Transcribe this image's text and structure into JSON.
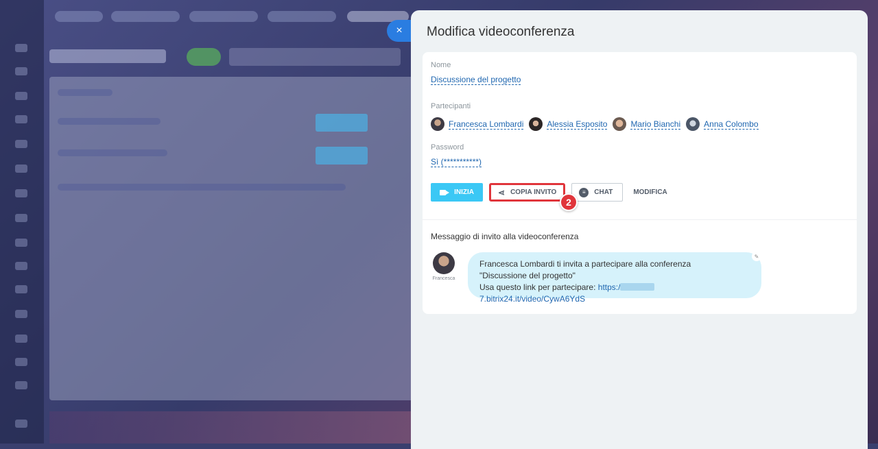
{
  "panel": {
    "title": "Modifica videoconferenza",
    "close_label": "×"
  },
  "conference": {
    "name_label": "Nome",
    "name_value": "Discussione del progetto",
    "participants_label": "Partecipanti",
    "participants": [
      {
        "name": "Francesca Lombardi"
      },
      {
        "name": "Alessia Esposito"
      },
      {
        "name": "Mario Bianchi"
      },
      {
        "name": "Anna Colombo"
      }
    ],
    "password_label": "Password",
    "password_value": "Sì (***********)"
  },
  "actions": {
    "start_label": "INIZIA",
    "copy_label": "COPIA INVITO",
    "chat_label": "CHAT",
    "edit_label": "MODIFICA",
    "step_badge": "2"
  },
  "invite": {
    "heading": "Messaggio di invito alla videoconferenza",
    "sender_name": "Francesca",
    "line1": "Francesca Lombardi ti invita a partecipare alla conferenza",
    "line2": "\"Discussione del progetto\"",
    "line3_prefix": "Usa questo link per partecipare:",
    "link_start": "https:/",
    "link_end": "7.bitrix24.it/video/CywA6YdS"
  },
  "colors": {
    "accent": "#3bc8f5",
    "highlight": "#e0353b",
    "link": "#2067b0"
  }
}
